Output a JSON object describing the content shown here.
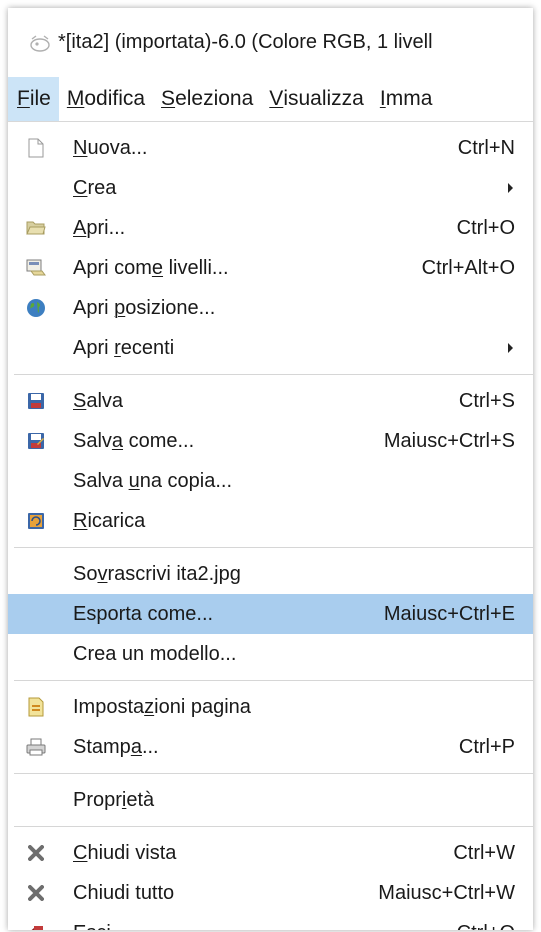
{
  "window": {
    "title": "*[ita2] (importata)-6.0 (Colore RGB, 1 livell"
  },
  "menubar": {
    "items": [
      {
        "pre": "",
        "key": "F",
        "post": "ile"
      },
      {
        "pre": "",
        "key": "M",
        "post": "odifica"
      },
      {
        "pre": "",
        "key": "S",
        "post": "eleziona"
      },
      {
        "pre": "",
        "key": "V",
        "post": "isualizza"
      },
      {
        "pre": "",
        "key": "I",
        "post": "mma"
      }
    ]
  },
  "file_menu": {
    "items": [
      {
        "pre": "",
        "key": "N",
        "post": "uova...",
        "shortcut": "Ctrl+N",
        "icon": "new-document-icon"
      },
      {
        "pre": "",
        "key": "C",
        "post": "rea",
        "shortcut": "",
        "submenu": true
      },
      {
        "pre": "",
        "key": "A",
        "post": "pri...",
        "shortcut": "Ctrl+O",
        "icon": "open-folder-icon"
      },
      {
        "pre": "Apri com",
        "key": "e",
        "post": " livelli...",
        "shortcut": "Ctrl+Alt+O",
        "icon": "open-as-layers-icon"
      },
      {
        "pre": "Apri ",
        "key": "p",
        "post": "osizione...",
        "shortcut": "",
        "icon": "globe-icon"
      },
      {
        "pre": "Apri ",
        "key": "r",
        "post": "ecenti",
        "shortcut": "",
        "submenu": true
      },
      {
        "pre": "",
        "key": "S",
        "post": "alva",
        "shortcut": "Ctrl+S",
        "icon": "save-icon"
      },
      {
        "pre": "Salv",
        "key": "a",
        "post": " come...",
        "shortcut": "Maiusc+Ctrl+S",
        "icon": "save-as-icon"
      },
      {
        "pre": "Salva ",
        "key": "u",
        "post": "na copia...",
        "shortcut": ""
      },
      {
        "pre": "",
        "key": "R",
        "post": "icarica",
        "shortcut": "",
        "icon": "revert-icon"
      },
      {
        "pre": "So",
        "key": "v",
        "post": "rascrivi ita2.jpg",
        "shortcut": ""
      },
      {
        "pre": "Esporta come...",
        "key": "",
        "post": "",
        "shortcut": "Maiusc+Ctrl+E"
      },
      {
        "pre": "Crea un modello...",
        "key": "",
        "post": "",
        "shortcut": ""
      },
      {
        "pre": "Imposta",
        "key": "z",
        "post": "ioni pagina",
        "shortcut": "",
        "icon": "page-setup-icon"
      },
      {
        "pre": "Stamp",
        "key": "a",
        "post": "...",
        "shortcut": "Ctrl+P",
        "icon": "printer-icon"
      },
      {
        "pre": "Propr",
        "key": "i",
        "post": "età",
        "shortcut": ""
      },
      {
        "pre": "",
        "key": "C",
        "post": "hiudi vista",
        "shortcut": "Ctrl+W",
        "icon": "close-view-icon"
      },
      {
        "pre": "Chiudi tutto",
        "key": "",
        "post": "",
        "shortcut": "Maiusc+Ctrl+W",
        "icon": "close-all-icon"
      },
      {
        "pre": "",
        "key": "E",
        "post": "sci",
        "shortcut": "Ctrl+Q",
        "icon": "quit-icon"
      }
    ]
  },
  "colors": {
    "highlight": "#a9cdee",
    "menubar_active": "#cce4f7",
    "separator": "#d6d6d6"
  }
}
